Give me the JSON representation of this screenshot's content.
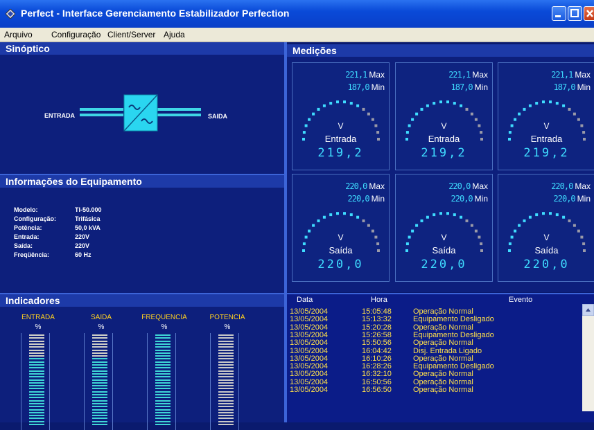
{
  "window": {
    "title": "Perfect - Interface Gerenciamento Estabilizador Perfection"
  },
  "menu": [
    {
      "label": "Arquivo"
    },
    {
      "label": "Configuração"
    },
    {
      "label": "Client/Server"
    },
    {
      "label": "Ajuda"
    }
  ],
  "sinoptico": {
    "header": "Sinóptico",
    "entrada_label": "ENTRADA",
    "saida_label": "SAIDA"
  },
  "medicoes": {
    "header": "Medições",
    "unit": "V",
    "max_label": "Max",
    "min_label": "Min",
    "gauges": [
      {
        "label": "Entrada",
        "max": "221,1",
        "min": "187,0",
        "value": "219,2"
      },
      {
        "label": "Entrada",
        "max": "221,1",
        "min": "187,0",
        "value": "219,2"
      },
      {
        "label": "Entrada",
        "max": "221,1",
        "min": "187,0",
        "value": "219,2"
      },
      {
        "label": "Saída",
        "max": "220,0",
        "min": "220,0",
        "value": "220,0"
      },
      {
        "label": "Saída",
        "max": "220,0",
        "min": "220,0",
        "value": "220,0"
      },
      {
        "label": "Saída",
        "max": "220,0",
        "min": "220,0",
        "value": "220,0"
      }
    ]
  },
  "info": {
    "header": "Informações do Equipamento",
    "rows": [
      {
        "key": "Modelo:",
        "value": "TI-50.000"
      },
      {
        "key": "Configuração:",
        "value": "Trifásica"
      },
      {
        "key": "Potência:",
        "value": "50,0 kVA"
      },
      {
        "key": "Entrada:",
        "value": "220V"
      },
      {
        "key": "Saída:",
        "value": "220V"
      },
      {
        "key": "Freqüência:",
        "value": "60 Hz"
      }
    ]
  },
  "indicadores": {
    "header": "Indicadores",
    "pct": "%",
    "items": [
      {
        "label": "ENTRADA",
        "color": "#3fd6d6"
      },
      {
        "label": "SAIDA",
        "color": "#3fd6d6"
      },
      {
        "label": "FREQUENCIA",
        "color": "#3fd6d6"
      },
      {
        "label": "POTENCIA",
        "color": "#c8c8c8"
      }
    ]
  },
  "eventos": {
    "columns": [
      "Data",
      "Hora",
      "Evento"
    ],
    "rows": [
      {
        "data": "13/05/2004",
        "hora": "15:05:48",
        "evento": "Operação Normal"
      },
      {
        "data": "13/05/2004",
        "hora": "15:13:32",
        "evento": "Equipamento Desligado"
      },
      {
        "data": "13/05/2004",
        "hora": "15:20:28",
        "evento": "Operação Normal"
      },
      {
        "data": "13/05/2004",
        "hora": "15:26:58",
        "evento": "Equipamento Desligado"
      },
      {
        "data": "13/05/2004",
        "hora": "15:50:56",
        "evento": "Operação Normal"
      },
      {
        "data": "13/05/2004",
        "hora": "16:04:42",
        "evento": "Disj. Entrada Ligado"
      },
      {
        "data": "13/05/2004",
        "hora": "16:10:26",
        "evento": "Operação Normal"
      },
      {
        "data": "13/05/2004",
        "hora": "16:28:26",
        "evento": "Equipamento Desligado"
      },
      {
        "data": "13/05/2004",
        "hora": "16:32:10",
        "evento": "Operação Normal"
      },
      {
        "data": "13/05/2004",
        "hora": "16:50:56",
        "evento": "Operação Normal"
      },
      {
        "data": "13/05/2004",
        "hora": "16:56:50",
        "evento": "Operação Normal"
      }
    ]
  },
  "colors": {
    "accent": "#3fdcff",
    "event_text": "#ffe04a",
    "panel": "#0d1f7c"
  }
}
